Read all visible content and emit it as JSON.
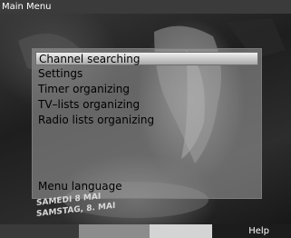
{
  "window": {
    "title": "Main Menu"
  },
  "menu": {
    "items": [
      {
        "label": "Channel searching",
        "selected": true
      },
      {
        "label": "Settings",
        "selected": false
      },
      {
        "label": "Timer organizing",
        "selected": false
      },
      {
        "label": "TV–lists organizing",
        "selected": false
      },
      {
        "label": "Radio lists organizing",
        "selected": false
      }
    ],
    "language_item": {
      "label": "Menu language"
    }
  },
  "background": {
    "date_fr": "SAMEDI 8 MAI",
    "date_de": "SAMSTAG, 8. MAI"
  },
  "footer": {
    "buttons": [
      {
        "name": "red",
        "color": "#3a3a3a"
      },
      {
        "name": "green",
        "color": "#8c8c8c"
      },
      {
        "name": "yellow",
        "color": "#d4d4d4"
      },
      {
        "name": "blue",
        "color": "#1c1c1c"
      }
    ],
    "help_label": "Help"
  }
}
